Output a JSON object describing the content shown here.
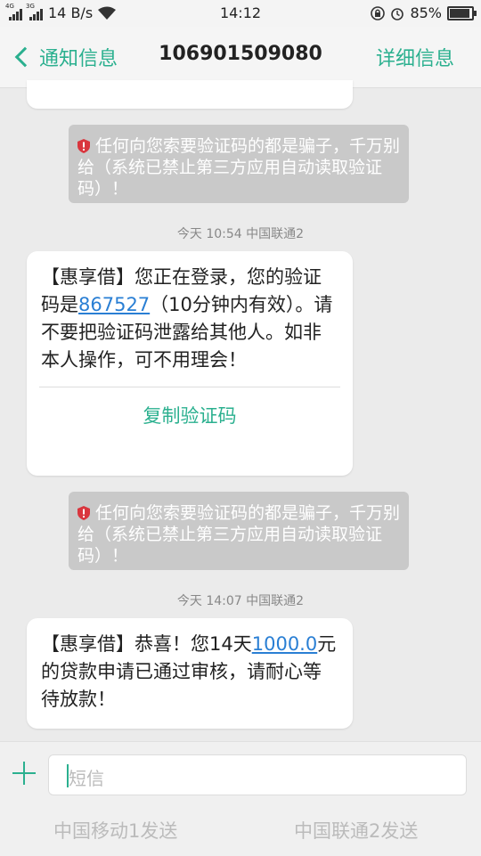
{
  "status": {
    "net1": "4G",
    "net2": "3G",
    "speed": "14 B/s",
    "time": "14:12",
    "battery": "85%",
    "battery_level": 0.85
  },
  "header": {
    "back_label": "通知信息",
    "title": "106901509080",
    "detail_label": "详细信息"
  },
  "warning_text": "任何向您索要验证码的都是骗子，千万别给（系统已禁止第三方应用自动读取验证码）！",
  "messages": [
    {
      "stamp": "今天 10:54  中国联通2",
      "pre": "【惠享借】您正在登录，您的验证码是",
      "code": "867527",
      "post": "（10分钟内有效）。请不要把验证码泄露给其他人。如非本人操作，可不用理会！",
      "action": "复制验证码"
    },
    {
      "stamp": "今天 14:07  中国联通2",
      "pre": "【惠享借】恭喜！您14天",
      "amount": "1000.0",
      "post": "元的贷款申请已通过审核，请耐心等待放款！"
    }
  ],
  "input": {
    "placeholder": "短信",
    "send1": "中国移动1发送",
    "send2": "中国联通2发送"
  },
  "colors": {
    "accent": "#2bb08f",
    "link": "#2a7fd4",
    "warning_bg": "#c9c9c9",
    "warning_icon": "#d9363e"
  }
}
